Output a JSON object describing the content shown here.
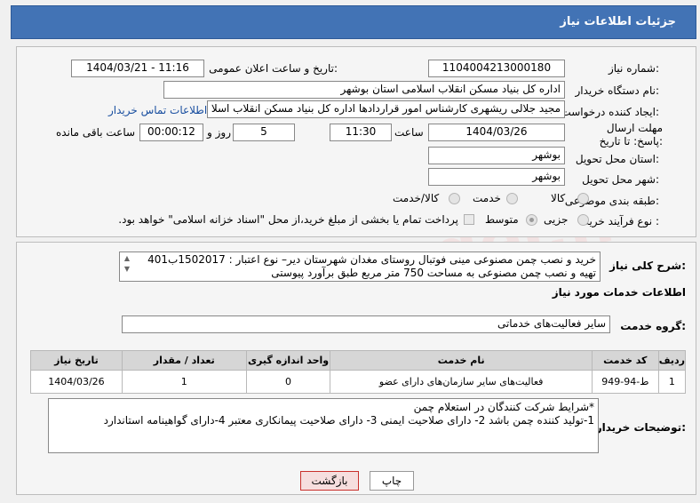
{
  "header": {
    "title": "جزئیات اطلاعات نیاز"
  },
  "fields": {
    "need_number_label": "شماره نیاز:",
    "need_number": "1104004213000180",
    "announce_label": "تاریخ و ساعت اعلان عمومی:",
    "announce_value": "1404/03/21 - 11:16",
    "buyer_org_label": "نام دستگاه خریدار:",
    "buyer_org": "اداره کل بنیاد مسکن انقلاب اسلامی استان بوشهر",
    "requester_label": "ایجاد کننده درخواست:",
    "requester": "مجید جلالی ریشهری کارشناس امور قراردادها اداره کل بنیاد مسکن انقلاب اسلا",
    "contact_link": "اطلاعات تماس خریدار",
    "deadline_label": "مهلت ارسال پاسخ: تا تاریخ:",
    "deadline_date": "1404/03/26",
    "hour_label": "ساعت",
    "deadline_time": "11:30",
    "days_value": "5",
    "days_label": "روز و",
    "remaining_time": "00:00:12",
    "remaining_label": "ساعت باقی مانده",
    "province_label": "استان محل تحویل:",
    "province": "بوشهر",
    "city_label": "شهر محل تحویل:",
    "city": "بوشهر",
    "category_label": "طبقه بندی موضوعی:",
    "category_options": [
      "کالا",
      "خدمت",
      "کالا/خدمت"
    ],
    "process_label": "نوع فرآیند خرید :",
    "process_options": [
      "جزیی",
      "متوسط"
    ],
    "payment_note": "پرداخت تمام یا بخشی از مبلغ خرید،از محل \"اسناد خزانه اسلامی\" خواهد بود."
  },
  "description": {
    "label": "شرح کلی نیاز:",
    "line1": "خرید و نصب چمن مصنوعی مینی فوتبال روستای مغدان  شهرستان دیر– نوع اعتبار : 1502017ب401",
    "line2": "تهیه و نصب چمن مصنوعی به مساحت 750 متر مربع طبق برآورد پیوستی"
  },
  "services": {
    "section_title": "اطلاعات خدمات مورد نیاز",
    "group_label": "گروه خدمت:",
    "group_value": "سایر فعالیت‌های خدماتی",
    "columns": [
      "ردیف",
      "کد خدمت",
      "نام خدمت",
      "واحد اندازه گیری",
      "تعداد / مقدار",
      "تاریخ نیاز"
    ],
    "rows": [
      [
        "1",
        "ط-94-949",
        "فعالیت‌های سایر سازمان‌های دارای عضو",
        "0",
        "1",
        "1404/03/26"
      ]
    ]
  },
  "buyer_notes": {
    "label": "توضیحات خریدار:",
    "line1": "*شرایط شرکت کنندگان در استعلام چمن",
    "line2": "1-تولید کننده چمن باشد  2- دارای صلاحیت ایمنی 3- دارای صلاحیت پیمانکاری معتبر 4-دارای گواهینامه استاندارد"
  },
  "buttons": {
    "print": "چاپ",
    "back": "بازگشت"
  },
  "watermark": "AriaTender.net",
  "colors": {
    "header": "#4273b5",
    "link": "#1a4fa0"
  },
  "icons": {
    "scroll": "scroll-arrows-icon"
  }
}
